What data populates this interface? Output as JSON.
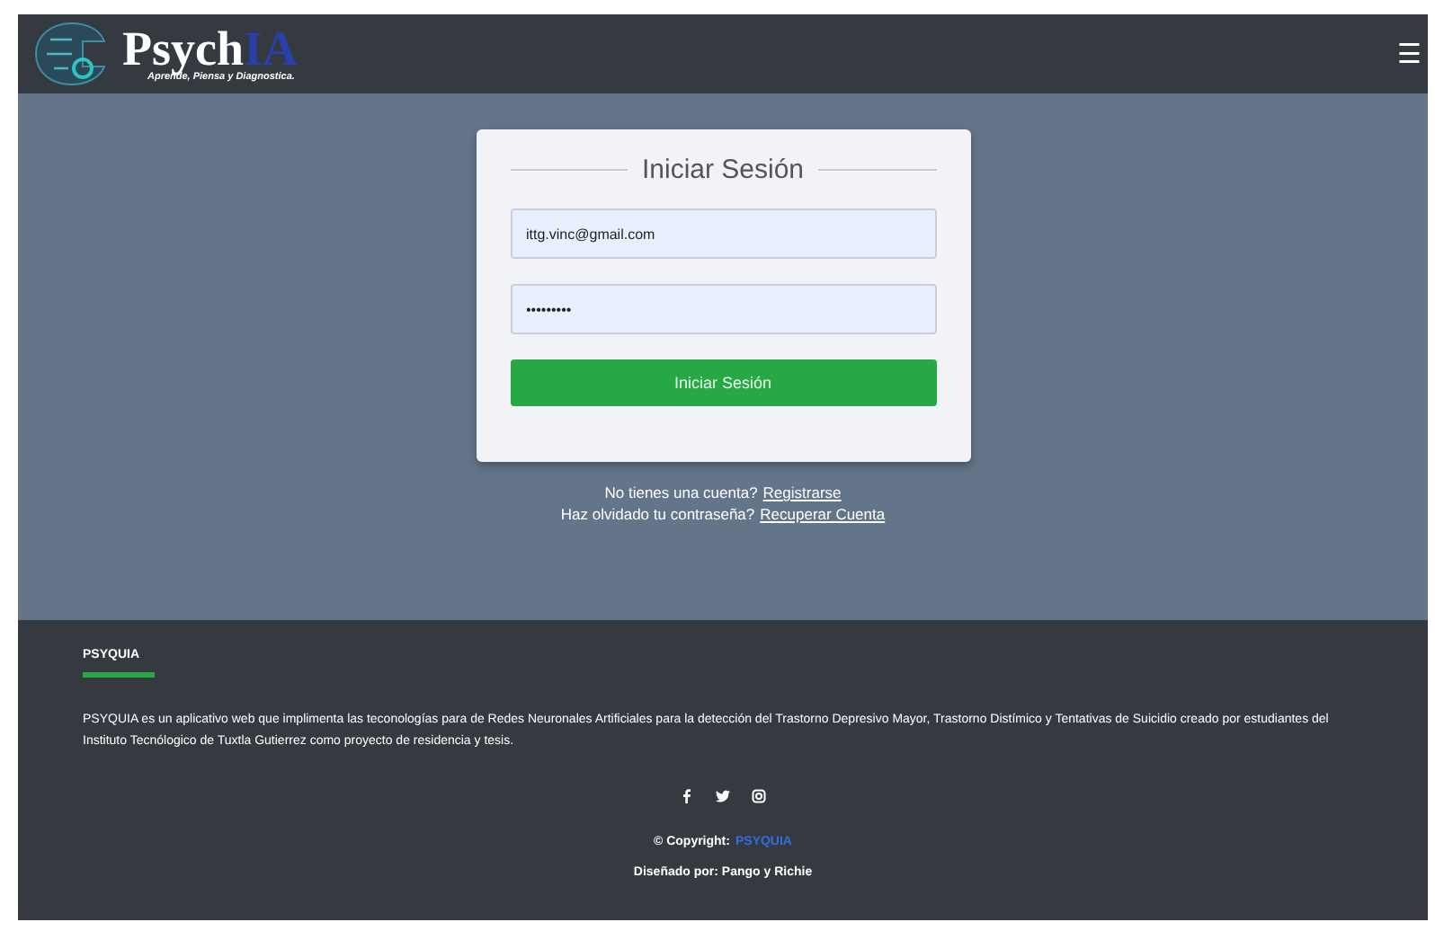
{
  "navbar": {
    "brand_main": "Psych",
    "brand_accent": "IA",
    "tagline": "Aprende, Piensa y Diagnostica.",
    "menu_icon": "☰"
  },
  "login": {
    "title": "Iniciar Sesión",
    "email": {
      "value": "ittg.vinc@gmail.com"
    },
    "password": {
      "value": "•••••••••"
    },
    "submit": "Iniciar Sesión"
  },
  "links": [
    {
      "text": "No tienes una cuenta?",
      "link": "Registrarse"
    },
    {
      "text": "Haz olvidado tu contraseña?",
      "link": "Recuperar Cuenta"
    }
  ],
  "footer": {
    "heading": "PSYQUIA",
    "description": "PSYQUIA es un aplicativo web que implimenta las teconologías para de Redes Neuronales Artificiales para la detección del Trastorno Depresivo Mayor, Trastorno Distímico y Tentativas de Suicidio creado por estudiantes del Instituto Tecnólogico de Tuxtla Gutierrez como proyecto de residencia y tesis.",
    "social": [
      {
        "kind": "facebook"
      },
      {
        "kind": "twitter"
      },
      {
        "kind": "instagram"
      }
    ],
    "copyright": "© Copyright:",
    "copyright_link": "PSYQUIA",
    "credits": "Diseñado por: Pango y Richie"
  }
}
